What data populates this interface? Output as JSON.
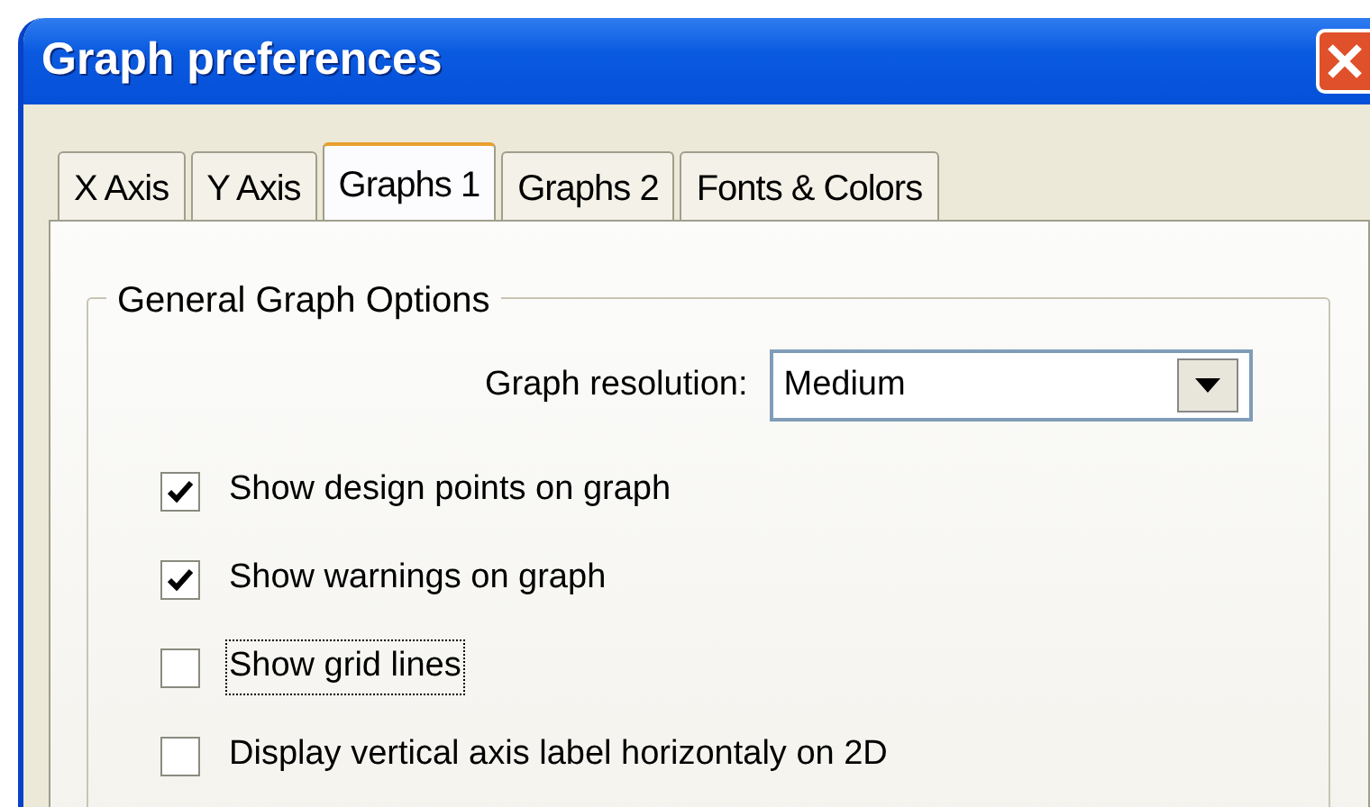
{
  "window": {
    "title": "Graph preferences"
  },
  "tabs": [
    {
      "label": "X Axis",
      "selected": false
    },
    {
      "label": "Y Axis",
      "selected": false
    },
    {
      "label": "Graphs 1",
      "selected": true
    },
    {
      "label": "Graphs 2",
      "selected": false
    },
    {
      "label": "Fonts & Colors",
      "selected": false
    }
  ],
  "group": {
    "title": "General Graph Options",
    "resolution": {
      "label": "Graph resolution:",
      "value": "Medium"
    },
    "options": [
      {
        "label": "Show design points on graph",
        "checked": true,
        "focused": false
      },
      {
        "label": "Show warnings on graph",
        "checked": true,
        "focused": false
      },
      {
        "label": "Show grid lines",
        "checked": false,
        "focused": true
      },
      {
        "label": "Display vertical axis label horizontaly on 2D",
        "checked": false,
        "focused": false
      }
    ]
  }
}
